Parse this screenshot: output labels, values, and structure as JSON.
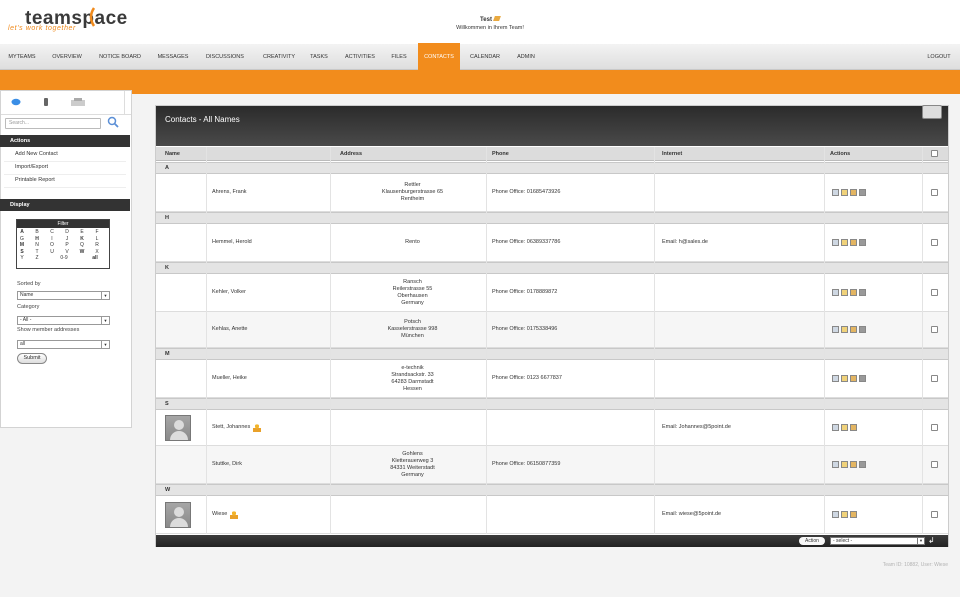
{
  "app": {
    "logo_text": "teamspace",
    "tagline": "let's work together"
  },
  "welcome": {
    "user": "Test",
    "message": "Willkommen in Ihrem Team!"
  },
  "nav": {
    "items": [
      "MYTEAMS",
      "OVERVIEW",
      "NOTICE BOARD",
      "MESSAGES",
      "DISCUSSIONS",
      "CREATIVITY",
      "TASKS",
      "ACTIVITIES",
      "FILES",
      "CONTACTS",
      "CALENDAR",
      "ADMIN"
    ],
    "active": "CONTACTS",
    "logout": "LOGOUT"
  },
  "sidebar": {
    "search_placeholder": "Search...",
    "actions_header": "Actions",
    "actions": [
      "Add New Contact",
      "Import/Export",
      "Printable Report"
    ],
    "display_header": "Display",
    "filter": {
      "title": "Filter",
      "letters": [
        "A",
        "B",
        "C",
        "D",
        "E",
        "F",
        "G",
        "H",
        "I",
        "J",
        "K",
        "L",
        "M",
        "N",
        "O",
        "P",
        "Q",
        "R",
        "S",
        "T",
        "U",
        "V",
        "W",
        "X",
        "Y",
        "Z",
        "0-9",
        "all"
      ],
      "bold": [
        "A",
        "H",
        "K",
        "M",
        "S",
        "W",
        "all"
      ]
    },
    "sorted_by_label": "Sorted by",
    "sorted_by_value": "Name",
    "category_label": "Category",
    "category_value": "- All -",
    "show_member_label": "Show member addresses",
    "show_member_value": "all",
    "submit": "Submit"
  },
  "panel": {
    "title": "Contacts - All Names",
    "columns": [
      "Name",
      "Address",
      "Phone",
      "Internet",
      "Actions"
    ],
    "groups": [
      {
        "letter": "A",
        "rows": [
          {
            "name": "Ahrens, Frank",
            "address": [
              "Rettler",
              "Klausenburgerstrasse 65",
              "Rentheim"
            ],
            "phone": "Phone Office: 01685473926",
            "internet": "",
            "avatar": false,
            "member": false,
            "actions": 4
          }
        ]
      },
      {
        "letter": "H",
        "rows": [
          {
            "name": "Hemmel, Herold",
            "address": [
              "Rento"
            ],
            "phone": "Phone Office: 06389337786",
            "internet": "Email: h@sales.de",
            "avatar": false,
            "member": false,
            "actions": 4
          }
        ]
      },
      {
        "letter": "K",
        "rows": [
          {
            "name": "Kehler, Volker",
            "address": [
              "Ransch",
              "Reilerstrasse 55",
              "Oberhausen",
              "Germany"
            ],
            "phone": "Phone Office: 0178889872",
            "internet": "",
            "avatar": false,
            "member": false,
            "actions": 4
          },
          {
            "name": "Kehlas, Anette",
            "address": [
              "Potsch",
              "Kasselerstrasse 998",
              "München"
            ],
            "phone": "Phone Office: 0175338496",
            "internet": "",
            "avatar": false,
            "member": false,
            "actions": 4
          }
        ]
      },
      {
        "letter": "M",
        "rows": [
          {
            "name": "Mueller, Heike",
            "address": [
              "e-technik",
              "Strandsackstr. 33",
              "64283 Darmstadt",
              "Hessen"
            ],
            "phone": "Phone Office: 0123 6677837",
            "internet": "",
            "avatar": false,
            "member": false,
            "actions": 4
          }
        ]
      },
      {
        "letter": "S",
        "rows": [
          {
            "name": "Stett, Johannes",
            "address": [],
            "phone": "",
            "internet": "Email: Johannes@5point.de",
            "avatar": true,
            "member": true,
            "actions": 3
          },
          {
            "name": "Stuttke, Dirk",
            "address": [
              "Gohlens",
              "Kletterauerweg 3",
              "84331 Weiterstadt",
              "Germany"
            ],
            "phone": "Phone Office: 06150877359",
            "internet": "",
            "avatar": false,
            "member": false,
            "actions": 4
          }
        ]
      },
      {
        "letter": "W",
        "rows": [
          {
            "name": "Wiese",
            "address": [],
            "phone": "",
            "internet": "Email: wiese@5point.de",
            "avatar": true,
            "member": true,
            "actions": 3
          }
        ]
      }
    ],
    "footer_action_label": "Action",
    "footer_select_value": "- select -"
  },
  "footer_text": "Team ID: 10882, User: Wiese",
  "colors": {
    "accent": "#f28c1c",
    "dark": "#333333"
  }
}
